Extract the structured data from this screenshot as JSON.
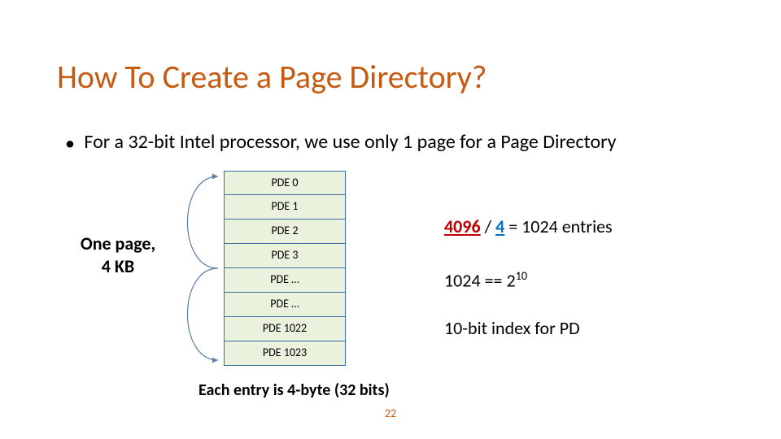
{
  "title": "How To Create a Page Directory?",
  "bullet": "For a 32-bit Intel processor, we use only 1 page for a Page Directory",
  "one_page": {
    "line1": "One page,",
    "line2": "4 KB"
  },
  "pde": {
    "rows": [
      "PDE 0",
      "PDE 1",
      "PDE 2",
      "PDE 3",
      "PDE …",
      "PDE …",
      "PDE 1022",
      "PDE 1023"
    ]
  },
  "caption": "Each entry is 4-byte (32 bits)",
  "annotations": {
    "line1": {
      "a": "4096",
      "b": "4",
      "rest": " = 1024 entries"
    },
    "line2_pre": "1024 == 2",
    "line2_exp": "10",
    "line3": "10-bit index for PD"
  },
  "page_number": "22"
}
